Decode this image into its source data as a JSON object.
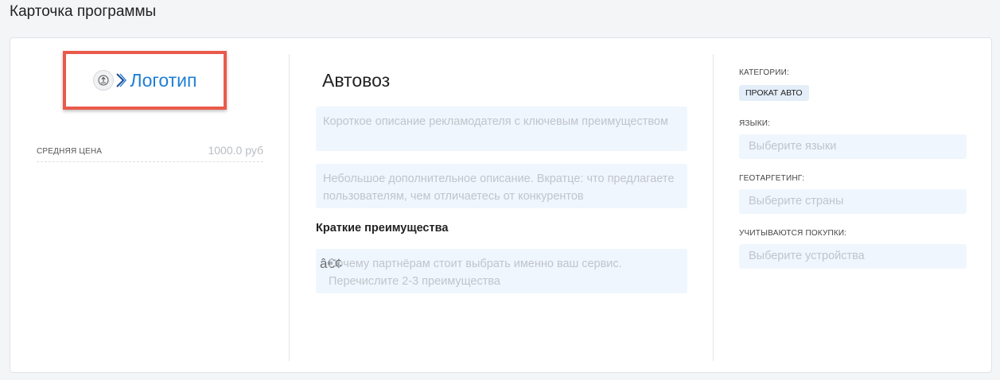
{
  "page": {
    "title": "Карточка программы"
  },
  "logo": {
    "label": "Логотип",
    "icon": "upload-icon"
  },
  "price": {
    "label": "СРЕДНЯЯ ЦЕНА",
    "value": "1000.0 руб"
  },
  "program": {
    "name": "Автовоз",
    "short_description_placeholder": "Короткое описание рекламодателя с ключевым преимуществом",
    "description_placeholder": "Небольшое дополнительное описание. Вкратце: что предлагаете пользователям, чем отличаетесь от конкурентов",
    "advantages_title": "Краткие преимущества",
    "advantages_icon_glyph": "â€¢",
    "advantages_placeholder_line1": "Почему партнёрам стоит выбрать именно ваш сервис.",
    "advantages_placeholder_line2": "Перечислите 2-3 преимущества"
  },
  "sidebar": {
    "categories_label": "КАТЕГОРИИ:",
    "category_tag": "ПРОКАТ АВТО",
    "languages_label": "ЯЗЫКИ:",
    "languages_placeholder": "Выберите языки",
    "geo_label": "ГЕОТАРГЕТИНГ:",
    "geo_placeholder": "Выберите страны",
    "purchases_label": "УЧИТЫВАЮТСЯ ПОКУПКИ:",
    "purchases_placeholder": "Выберите устройства"
  },
  "colors": {
    "highlight_border": "#ea5a4a",
    "logo_text": "#1f7ed6",
    "field_background": "#f0f6fd",
    "tag_background": "#e4eef8"
  }
}
